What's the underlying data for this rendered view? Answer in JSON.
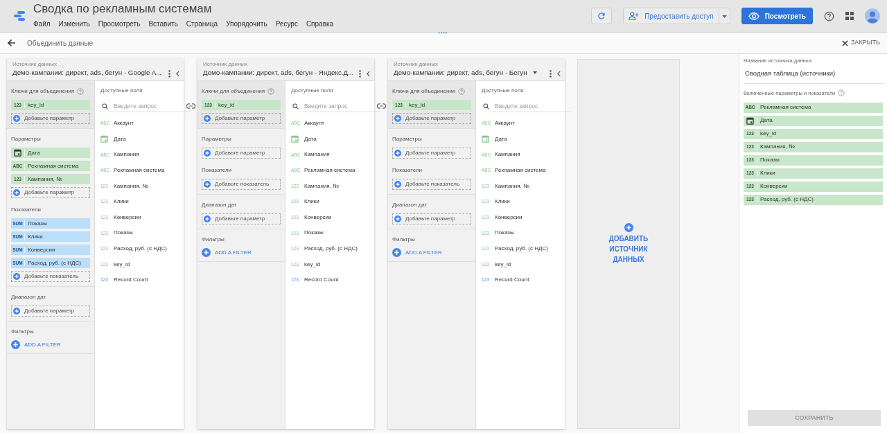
{
  "app": {
    "title": "Сводка по рекламным системам",
    "menu": [
      "Файл",
      "Изменить",
      "Просмотреть",
      "Вставить",
      "Страница",
      "Упорядочить",
      "Ресурс",
      "Справка"
    ],
    "share": "Предоставить доступ",
    "view": "Посмотреть"
  },
  "subbar": {
    "title": "Объединить данные",
    "close": "ЗАКРЫТЬ"
  },
  "sources": [
    {
      "label": "Источник данных",
      "name": "Демо-кампании: директ, ads, бегун - Google A...",
      "dropdown": false,
      "sections": [
        {
          "kind": "keys",
          "title": "Ключи для объединения",
          "items": [
            {
              "kind": "number",
              "badge": "123",
              "label": "key_id"
            }
          ],
          "add": "Добавьте параметр"
        },
        {
          "kind": "dimensions",
          "title": "Параметры",
          "items": [
            {
              "kind": "date",
              "label": "Дата"
            },
            {
              "kind": "text",
              "badge": "ABC",
              "label": "Рекламная система"
            },
            {
              "kind": "number",
              "badge": "123",
              "label": "Кампания, №"
            }
          ],
          "add": "Добавьте параметр"
        },
        {
          "kind": "metrics",
          "title": "Показатели",
          "items": [
            {
              "kind": "sum",
              "badge": "SUM",
              "label": "Показы"
            },
            {
              "kind": "sum",
              "badge": "SUM",
              "label": "Клики"
            },
            {
              "kind": "sum",
              "badge": "SUM",
              "label": "Конверсии"
            },
            {
              "kind": "sum",
              "badge": "SUM",
              "label": "Расход, руб. (с НДС)"
            }
          ],
          "add": "Добавьте показатель"
        },
        {
          "kind": "daterange",
          "title": "Диапазон дат",
          "add": "Добавьте параметр"
        },
        {
          "kind": "filters",
          "title": "Фильтры",
          "add": "ADD A FILTER"
        }
      ],
      "available": {
        "title": "Доступные поля",
        "placeholder": "Введите запрос",
        "fields": [
          {
            "kind": "text",
            "badge": "ABC",
            "label": "Аккаунт"
          },
          {
            "kind": "date",
            "label": "Дата"
          },
          {
            "kind": "text",
            "badge": "ABC",
            "label": "Кампания"
          },
          {
            "kind": "text",
            "badge": "ABC",
            "label": "Рекламная система"
          },
          {
            "kind": "number",
            "badge": "123",
            "label": "Кампания, №"
          },
          {
            "kind": "number",
            "badge": "123",
            "label": "Клики"
          },
          {
            "kind": "number",
            "badge": "123",
            "label": "Конверсии"
          },
          {
            "kind": "number",
            "badge": "123",
            "label": "Показы"
          },
          {
            "kind": "number",
            "badge": "123",
            "label": "Расход, руб. (с НДС)"
          },
          {
            "kind": "number",
            "badge": "123",
            "label": "key_id"
          },
          {
            "kind": "count",
            "badge": "123",
            "label": "Record Count"
          }
        ]
      }
    },
    {
      "label": "Источник данных",
      "name": "Демо-кампании: директ, ads, бегун - Яндекс.Д...",
      "dropdown": false,
      "sections": [
        {
          "kind": "keys",
          "title": "Ключи для объединения",
          "items": [
            {
              "kind": "number",
              "badge": "123",
              "label": "key_id"
            }
          ],
          "add": "Добавьте параметр"
        },
        {
          "kind": "dimensions",
          "title": "Параметры",
          "add": "Добавьте параметр"
        },
        {
          "kind": "metrics",
          "title": "Показатели",
          "add": "Добавьте показатель"
        },
        {
          "kind": "daterange",
          "title": "Диапазон дат",
          "add": "Добавьте параметр"
        },
        {
          "kind": "filters",
          "title": "Фильтры",
          "add": "ADD A FILTER"
        }
      ],
      "available": {
        "title": "Доступные поля",
        "placeholder": "Введите запрос",
        "fields": [
          {
            "kind": "text",
            "badge": "ABC",
            "label": "Аккаунт"
          },
          {
            "kind": "date",
            "label": "Дата"
          },
          {
            "kind": "text",
            "badge": "ABC",
            "label": "Кампания"
          },
          {
            "kind": "text",
            "badge": "ABC",
            "label": "Рекламная система"
          },
          {
            "kind": "number",
            "badge": "123",
            "label": "Кампания, №"
          },
          {
            "kind": "number",
            "badge": "123",
            "label": "Клики"
          },
          {
            "kind": "number",
            "badge": "123",
            "label": "Конверсии"
          },
          {
            "kind": "number",
            "badge": "123",
            "label": "Показы"
          },
          {
            "kind": "number",
            "badge": "123",
            "label": "Расход, руб. (с НДС)"
          },
          {
            "kind": "number",
            "badge": "123",
            "label": "key_id"
          },
          {
            "kind": "count",
            "badge": "123",
            "label": "Record Count"
          }
        ]
      }
    },
    {
      "label": "Источник данных",
      "name": "Демо-кампании: директ, ads, бегун - Бегун",
      "dropdown": true,
      "sections": [
        {
          "kind": "keys",
          "title": "Ключи для объединения",
          "items": [
            {
              "kind": "number",
              "badge": "123",
              "label": "key_id"
            }
          ],
          "add": "Добавьте параметр"
        },
        {
          "kind": "dimensions",
          "title": "Параметры",
          "add": "Добавьте параметр"
        },
        {
          "kind": "metrics",
          "title": "Показатели",
          "add": "Добавьте показатель"
        },
        {
          "kind": "daterange",
          "title": "Диапазон дат",
          "add": "Добавьте параметр"
        },
        {
          "kind": "filters",
          "title": "Фильтры",
          "add": "ADD A FILTER"
        }
      ],
      "available": {
        "title": "Доступные поля",
        "placeholder": "Введите запрос",
        "fields": [
          {
            "kind": "text",
            "badge": "ABC",
            "label": "Аккаунт"
          },
          {
            "kind": "date",
            "label": "Дата"
          },
          {
            "kind": "text",
            "badge": "ABC",
            "label": "Кампания"
          },
          {
            "kind": "text",
            "badge": "ABC",
            "label": "Рекламная система"
          },
          {
            "kind": "number",
            "badge": "123",
            "label": "Кампания, №"
          },
          {
            "kind": "number",
            "badge": "123",
            "label": "Клики"
          },
          {
            "kind": "number",
            "badge": "123",
            "label": "Конверсии"
          },
          {
            "kind": "number",
            "badge": "123",
            "label": "Показы"
          },
          {
            "kind": "number",
            "badge": "123",
            "label": "Расход, руб. (с НДС)"
          },
          {
            "kind": "number",
            "badge": "123",
            "label": "key_id"
          },
          {
            "kind": "count",
            "badge": "123",
            "label": "Record Count"
          }
        ]
      }
    }
  ],
  "add_source": "ДОБАВИТЬ ИСТОЧНИК ДАННЫХ",
  "panel": {
    "name_label": "Название источника данных",
    "name": "Сводная таблица (источники)",
    "included_label": "Включенные параметры и показатели",
    "included": [
      {
        "kind": "text",
        "badge": "ABC",
        "label": "Рекламная система"
      },
      {
        "kind": "date",
        "label": "Дата"
      },
      {
        "kind": "number",
        "badge": "123",
        "label": "key_id"
      },
      {
        "kind": "number",
        "badge": "123",
        "label": "Кампания, №"
      },
      {
        "kind": "number",
        "badge": "123",
        "label": "Показы"
      },
      {
        "kind": "number",
        "badge": "123",
        "label": "Клики"
      },
      {
        "kind": "number",
        "badge": "123",
        "label": "Конверсии"
      },
      {
        "kind": "number",
        "badge": "123",
        "label": "Расход, руб. (с НДС)"
      }
    ],
    "save": "СОХРАНИТЬ",
    "save_disabled": true
  }
}
